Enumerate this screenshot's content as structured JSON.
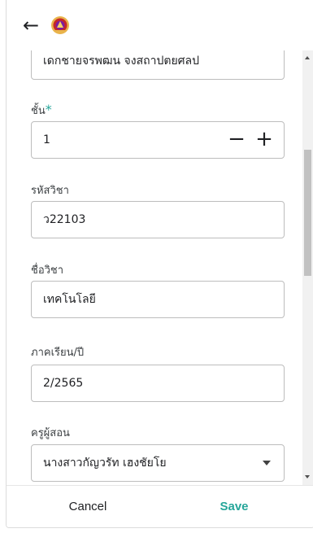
{
  "header": {
    "back_icon": "arrow-left-icon",
    "logo": "school-emblem"
  },
  "form": {
    "student_name": {
      "value": "เดกชายจรพฒน จงสถาปตยศลป"
    },
    "grade": {
      "label": "ชั้น",
      "required_mark": "*",
      "value": "1",
      "minus": "−",
      "plus": "+"
    },
    "subject_code": {
      "label": "รหัสวิชา",
      "value": "ว22103"
    },
    "subject_name": {
      "label": "ชื่อวิชา",
      "value": "เทคโนโลยี"
    },
    "term": {
      "label": "ภาคเรียน/ปี",
      "value": "2/2565"
    },
    "teacher": {
      "label": "ครูผู้สอน",
      "value": "นางสาวกัญวรัท เฮงชัยโย"
    }
  },
  "footer": {
    "cancel_label": "Cancel",
    "save_label": "Save"
  },
  "colors": {
    "accent": "#26a69a",
    "border": "#bdbdbd"
  }
}
